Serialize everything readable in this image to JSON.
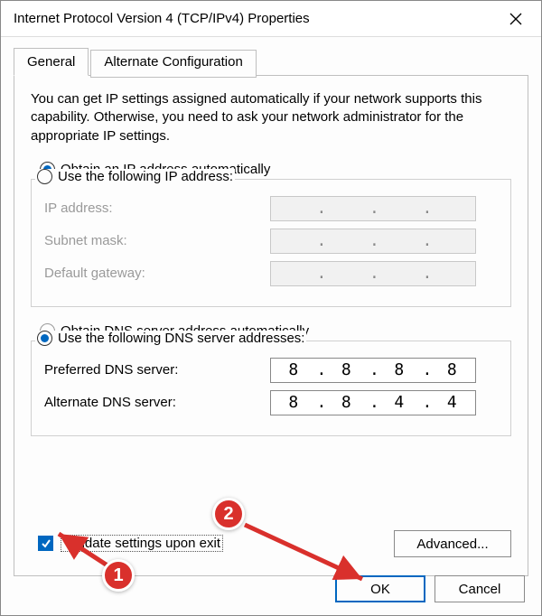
{
  "window": {
    "title": "Internet Protocol Version 4 (TCP/IPv4) Properties"
  },
  "tabs": {
    "general": "General",
    "alternate": "Alternate Configuration"
  },
  "description": "You can get IP settings assigned automatically if your network supports this capability. Otherwise, you need to ask your network administrator for the appropriate IP settings.",
  "ip_section": {
    "auto_label": "Obtain an IP address automatically",
    "manual_label": "Use the following IP address:",
    "selected": "auto",
    "ip_label": "IP address:",
    "subnet_label": "Subnet mask:",
    "gateway_label": "Default gateway:",
    "ip_value": [
      "",
      "",
      "",
      ""
    ],
    "subnet_value": [
      "",
      "",
      "",
      ""
    ],
    "gateway_value": [
      "",
      "",
      "",
      ""
    ]
  },
  "dns_section": {
    "auto_label": "Obtain DNS server address automatically",
    "manual_label": "Use the following DNS server addresses:",
    "selected": "manual",
    "preferred_label": "Preferred DNS server:",
    "alternate_label": "Alternate DNS server:",
    "preferred_value": [
      "8",
      "8",
      "8",
      "8"
    ],
    "alternate_value": [
      "8",
      "8",
      "4",
      "4"
    ]
  },
  "validate_label": "Validate settings upon exit",
  "validate_checked": true,
  "advanced_label": "Advanced...",
  "ok_label": "OK",
  "cancel_label": "Cancel",
  "annotations": {
    "callout1": "1",
    "callout2": "2"
  }
}
